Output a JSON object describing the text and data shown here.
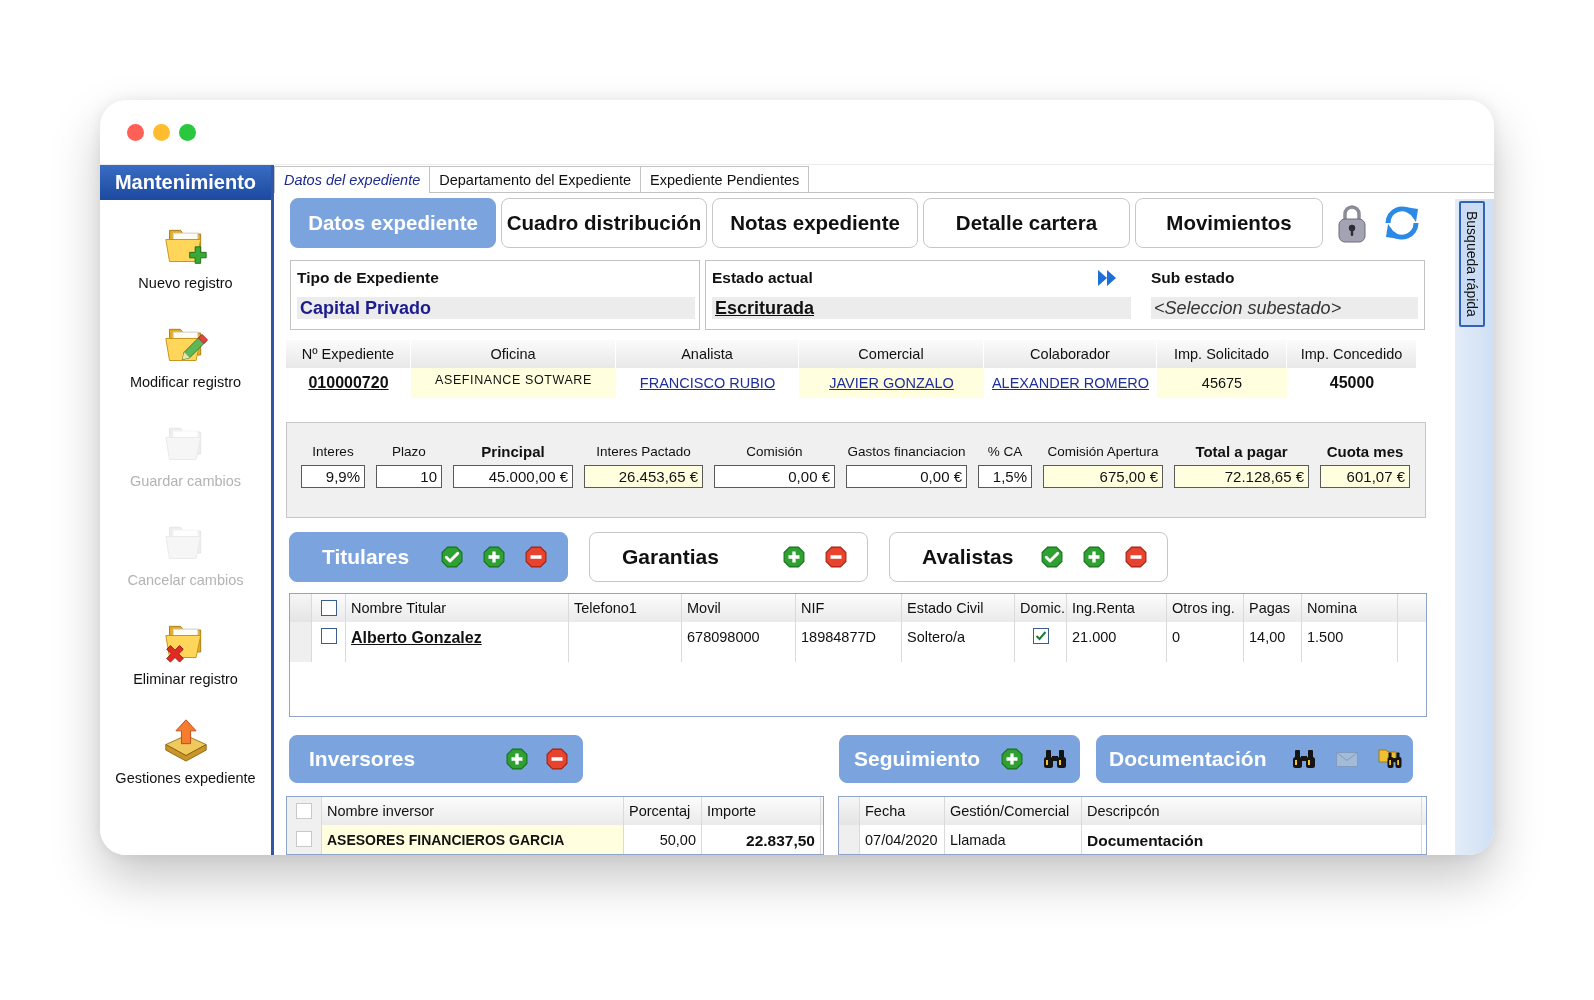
{
  "sidebar": {
    "title": "Mantenimiento",
    "items": [
      {
        "label": "Nuevo registro",
        "kind": "new",
        "disabled": false
      },
      {
        "label": "Modificar registro",
        "kind": "edit",
        "disabled": false
      },
      {
        "label": "Guardar cambios",
        "kind": "save",
        "disabled": true
      },
      {
        "label": "Cancelar cambios",
        "kind": "cancel",
        "disabled": true
      },
      {
        "label": "Eliminar registro",
        "kind": "delete",
        "disabled": false
      },
      {
        "label": "Gestiones expediente",
        "kind": "manage",
        "disabled": false
      }
    ]
  },
  "tabs": [
    {
      "label": "Datos del expediente",
      "selected": true
    },
    {
      "label": "Departamento del Expediente",
      "selected": false
    },
    {
      "label": "Expediente Pendientes",
      "selected": false
    }
  ],
  "section_buttons": [
    {
      "label": "Datos expediente",
      "selected": true
    },
    {
      "label": "Cuadro distribución",
      "selected": false
    },
    {
      "label": "Notas expediente",
      "selected": false
    },
    {
      "label": "Detalle cartera",
      "selected": false
    },
    {
      "label": "Movimientos",
      "selected": false
    }
  ],
  "status_panel": {
    "type": {
      "label": "Tipo de Expediente",
      "value": "Capital Privado"
    },
    "state": {
      "label": "Estado actual",
      "value": "Escriturada"
    },
    "substate": {
      "label": "Sub estado",
      "placeholder": "<Seleccion subestado>"
    }
  },
  "summary_table": {
    "columns": [
      "Nº Expediente",
      "Oficina",
      "Analista",
      "Comercial",
      "Colaborador",
      "Imp. Solicitado",
      "Imp. Concedido"
    ],
    "cells": [
      {
        "text": "010000720",
        "kind": "id",
        "highlighted": false
      },
      {
        "text": "ASEFINANCE SOTWARE",
        "kind": "code",
        "highlighted": true
      },
      {
        "text": "FRANCISCO RUBIO",
        "kind": "link",
        "highlighted": false
      },
      {
        "text": "JAVIER GONZALO",
        "kind": "link",
        "highlighted": true
      },
      {
        "text": "ALEXANDER ROMERO",
        "kind": "link",
        "highlighted": false
      },
      {
        "text": "45675",
        "kind": "text",
        "highlighted": true
      },
      {
        "text": "45000",
        "kind": "bold",
        "highlighted": false
      }
    ]
  },
  "amounts": [
    {
      "label": "Interes",
      "value": "9,9%",
      "bold": false,
      "highlighted": false
    },
    {
      "label": "Plazo",
      "value": "10",
      "bold": false,
      "highlighted": false
    },
    {
      "label": "Principal",
      "value": "45.000,00 €",
      "bold": true,
      "highlighted": false
    },
    {
      "label": "Interes Pactado",
      "value": "26.453,65 €",
      "bold": false,
      "highlighted": true
    },
    {
      "label": "Comisión",
      "value": "0,00 €",
      "bold": false,
      "highlighted": false
    },
    {
      "label": "Gastos financiacion",
      "value": "0,00 €",
      "bold": false,
      "highlighted": false
    },
    {
      "label": "% CA",
      "value": "1,5%",
      "bold": false,
      "highlighted": false
    },
    {
      "label": "Comisión Apertura",
      "value": "675,00 €",
      "bold": false,
      "highlighted": true
    },
    {
      "label": "Total a pagar",
      "value": "72.128,65 €",
      "bold": true,
      "highlighted": true
    },
    {
      "label": "Cuota mes",
      "value": "601,07 €",
      "bold": true,
      "highlighted": true
    }
  ],
  "holder_panels": [
    {
      "title": "Titulares",
      "selected": true,
      "actions": [
        {
          "kind": "confirm",
          "disabled": false
        },
        {
          "kind": "add",
          "disabled": false
        },
        {
          "kind": "remove",
          "disabled": false
        }
      ]
    },
    {
      "title": "Garantias",
      "selected": false,
      "actions": [
        {
          "kind": "add",
          "disabled": false
        },
        {
          "kind": "remove",
          "disabled": false
        }
      ]
    },
    {
      "title": "Avalistas",
      "selected": false,
      "actions": [
        {
          "kind": "confirm",
          "disabled": false
        },
        {
          "kind": "add",
          "disabled": false
        },
        {
          "kind": "remove",
          "disabled": false
        }
      ]
    }
  ],
  "holders_table": {
    "select_all": {
      "checked": false,
      "disabled": false
    },
    "columns": [
      "Nombre Titular",
      "Telefono1",
      "Movil",
      "NIF",
      "Estado Civil",
      "Domic.",
      "Ing.Renta",
      "Otros ing.",
      "Pagas",
      "Nomina"
    ],
    "rows": [
      {
        "checked": false,
        "disabled": false,
        "cells": [
          {
            "kind": "name",
            "text": "Alberto Gonzalez"
          },
          {
            "kind": "blank"
          },
          {
            "kind": "text",
            "text": "678098000"
          },
          {
            "kind": "text",
            "text": "18984877D"
          },
          {
            "kind": "text",
            "text": "Soltero/a"
          },
          {
            "kind": "check",
            "checked": true
          },
          {
            "kind": "text",
            "text": "21.000"
          },
          {
            "kind": "text",
            "text": "0"
          },
          {
            "kind": "text",
            "text": "14,00"
          },
          {
            "kind": "text",
            "text": "1.500"
          }
        ]
      }
    ]
  },
  "investors": {
    "header": {
      "title": "Inversores",
      "selected": true,
      "actions": [
        {
          "kind": "add",
          "disabled": false
        },
        {
          "kind": "remove",
          "disabled": false
        }
      ]
    },
    "select_all": {
      "checked": false,
      "disabled": true
    },
    "columns": [
      "Nombre inversor",
      "Porcentaj",
      "Importe"
    ],
    "rows": [
      {
        "checked": false,
        "disabled": true,
        "cells": [
          {
            "kind": "highlight",
            "text": "ASESORES FINANCIEROS GARCIA"
          },
          {
            "kind": "number",
            "text": "50,00"
          },
          {
            "kind": "amount",
            "text": "22.837,50"
          }
        ]
      }
    ]
  },
  "followup": {
    "header": {
      "title": "Seguimiento",
      "selected": true,
      "actions": [
        {
          "kind": "add",
          "disabled": false
        },
        {
          "kind": "search",
          "disabled": false
        }
      ]
    },
    "columns": [
      "Fecha",
      "Gestión/Comercial",
      "Descripcón"
    ],
    "rows": [
      {
        "cells": [
          {
            "kind": "text",
            "text": "07/04/2020"
          },
          {
            "kind": "text",
            "text": "Llamada"
          },
          {
            "kind": "bold",
            "text": "Documentación"
          }
        ]
      }
    ]
  },
  "documents": {
    "header": {
      "title": "Documentación",
      "selected": true,
      "actions": [
        {
          "kind": "search",
          "disabled": false
        },
        {
          "kind": "mail",
          "disabled": true
        },
        {
          "kind": "folder-search",
          "disabled": false
        }
      ]
    }
  },
  "quick_search": {
    "label": "Busqueda rápida"
  }
}
